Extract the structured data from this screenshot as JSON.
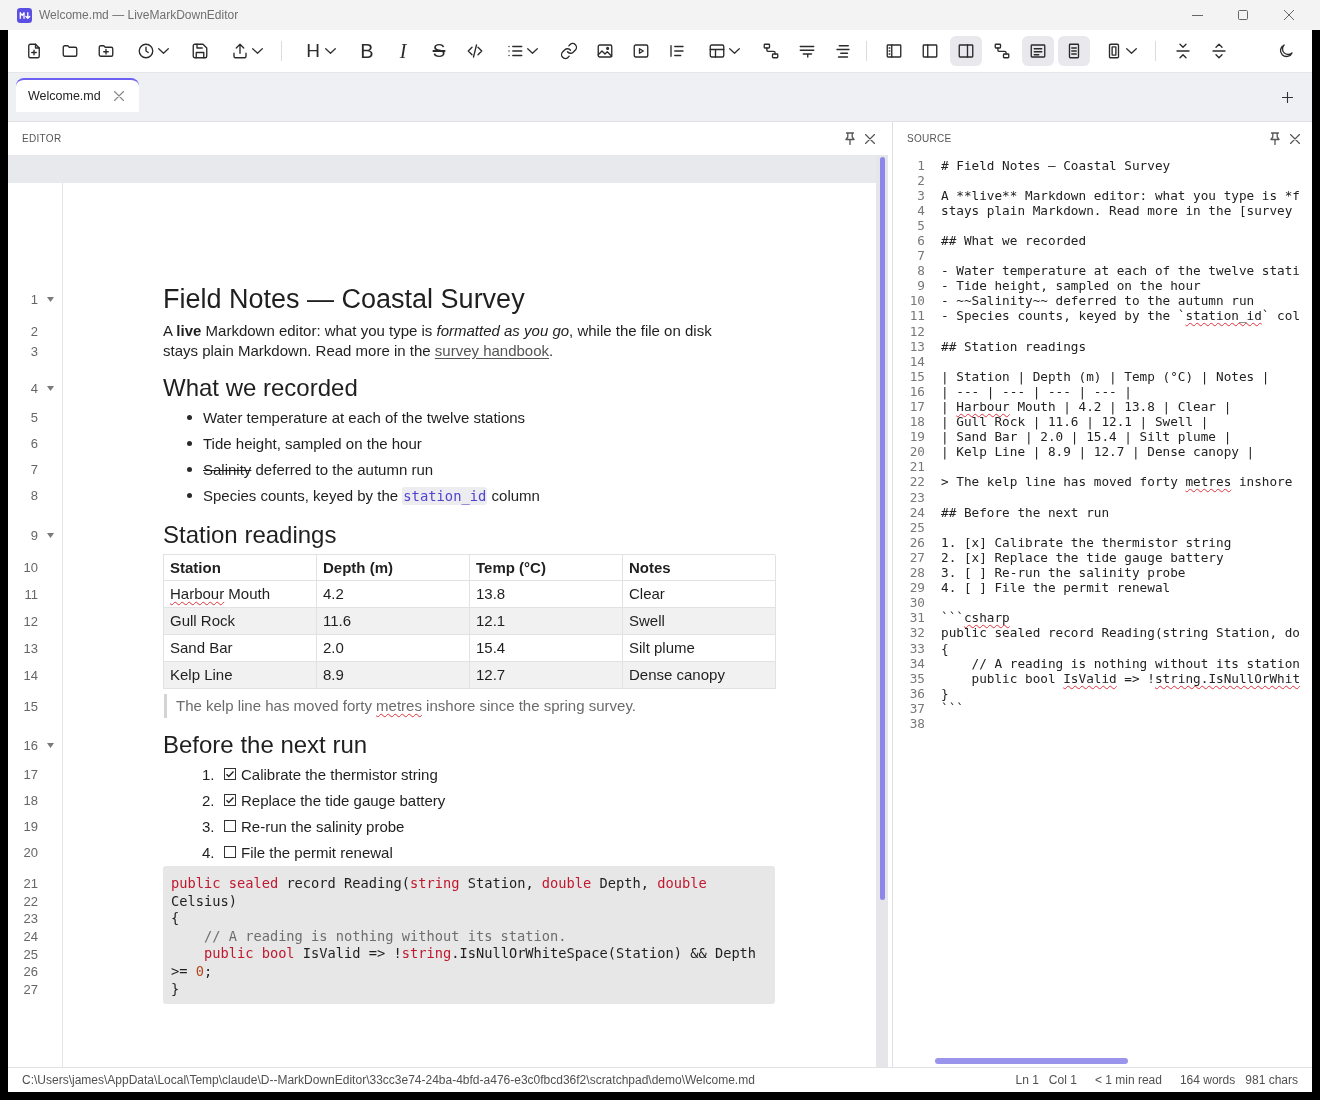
{
  "window": {
    "title": "Welcome.md — LiveMarkDownEditor"
  },
  "toolbar": [
    {
      "kind": "newfile",
      "selected": false,
      "dropdown": false
    },
    {
      "kind": "open",
      "selected": false,
      "dropdown": false
    },
    {
      "kind": "newfolder",
      "selected": false,
      "dropdown": false
    },
    {
      "kind": "history",
      "selected": false,
      "dropdown": true
    },
    {
      "kind": "save",
      "selected": false,
      "dropdown": false
    },
    {
      "kind": "export",
      "selected": false,
      "dropdown": true
    },
    {
      "kind": "separator"
    },
    {
      "kind": "heading",
      "label": "H",
      "selected": false,
      "dropdown": true
    },
    {
      "kind": "bold",
      "label": "B",
      "selected": false,
      "dropdown": false
    },
    {
      "kind": "italic",
      "label": "I",
      "selected": false,
      "dropdown": false
    },
    {
      "kind": "strike",
      "label": "S",
      "selected": false,
      "dropdown": false
    },
    {
      "kind": "code",
      "selected": false,
      "dropdown": false
    },
    {
      "kind": "list",
      "selected": false,
      "dropdown": true
    },
    {
      "kind": "link",
      "selected": false,
      "dropdown": false
    },
    {
      "kind": "image",
      "selected": false,
      "dropdown": false
    },
    {
      "kind": "video",
      "selected": false,
      "dropdown": false
    },
    {
      "kind": "quote",
      "selected": false,
      "dropdown": false
    },
    {
      "kind": "table",
      "selected": false,
      "dropdown": true
    },
    {
      "kind": "diagram",
      "selected": false,
      "dropdown": false
    },
    {
      "kind": "wrap",
      "selected": false,
      "dropdown": false
    },
    {
      "kind": "indent",
      "selected": false,
      "dropdown": false
    },
    {
      "kind": "separator"
    },
    {
      "kind": "sidebar",
      "selected": false,
      "dropdown": false
    },
    {
      "kind": "splitleft",
      "selected": false,
      "dropdown": false
    },
    {
      "kind": "splitright",
      "selected": true,
      "dropdown": false
    },
    {
      "kind": "diagram",
      "selected": false,
      "dropdown": false
    },
    {
      "kind": "prose",
      "selected": true,
      "dropdown": false
    },
    {
      "kind": "page",
      "selected": true,
      "dropdown": false
    },
    {
      "kind": "device",
      "selected": false,
      "dropdown": true
    },
    {
      "kind": "separator"
    },
    {
      "kind": "collapse",
      "selected": false,
      "dropdown": false
    },
    {
      "kind": "expand",
      "selected": false,
      "dropdown": false
    },
    {
      "kind": "theme",
      "selected": false,
      "dropdown": false
    }
  ],
  "tabs": [
    {
      "label": "Welcome.md",
      "selected": true
    }
  ],
  "editor": {
    "title": "EDITOR",
    "blocks": [
      {
        "kind": "heading1",
        "line_numbers": [
          "1"
        ],
        "expanded": true,
        "text": "Field Notes — Coastal Survey"
      },
      {
        "kind": "paragraph",
        "line_numbers": [
          "2",
          "3"
        ],
        "lines": [
          [
            {
              "kind": "text",
              "text": "A **live** Markdown editor: what you type is *formatted as you go*, while the file on disk"
            }
          ],
          [
            {
              "kind": "text",
              "text": "stays plain Markdown. Read more in the "
            },
            {
              "kind": "link",
              "text": "survey handbook"
            },
            {
              "kind": "text",
              "text": "."
            }
          ]
        ]
      },
      {
        "kind": "heading2",
        "line_numbers": [
          "4"
        ],
        "expanded": true,
        "text": "What we recorded"
      },
      {
        "kind": "bullet",
        "line_numbers": [
          "5"
        ],
        "segments": [
          {
            "kind": "text",
            "text": "Water temperature at each of the twelve stations"
          }
        ]
      },
      {
        "kind": "bullet",
        "line_numbers": [
          "6"
        ],
        "segments": [
          {
            "kind": "text",
            "text": "Tide height, sampled on the hour"
          }
        ]
      },
      {
        "kind": "bullet",
        "line_numbers": [
          "7"
        ],
        "segments": [
          {
            "kind": "strike",
            "text": "Salinity"
          },
          {
            "kind": "text",
            "text": " deferred to the autumn run"
          }
        ]
      },
      {
        "kind": "bullet",
        "line_numbers": [
          "8"
        ],
        "segments": [
          {
            "kind": "text",
            "text": "Species counts, keyed by the "
          },
          {
            "kind": "code",
            "text": "station_id"
          },
          {
            "kind": "text",
            "text": " column"
          }
        ]
      },
      {
        "kind": "heading2",
        "line_numbers": [
          "9"
        ],
        "expanded": true,
        "text": "Station readings"
      },
      {
        "kind": "table_header",
        "line_numbers": [
          "10"
        ],
        "cells": [
          "Station",
          "Depth (m)",
          "Temp (°C)",
          "Notes"
        ]
      },
      {
        "kind": "table_row",
        "line_numbers": [
          "11"
        ],
        "cells": [
          [
            {
              "kind": "misspelled",
              "text": "Harbour"
            },
            {
              "kind": "text",
              "text": " Mouth"
            }
          ],
          "4.2",
          "13.8",
          "Clear"
        ]
      },
      {
        "kind": "table_row",
        "line_numbers": [
          "12"
        ],
        "cells": [
          "Gull Rock",
          "11.6",
          "12.1",
          "Swell"
        ]
      },
      {
        "kind": "table_row",
        "line_numbers": [
          "13"
        ],
        "cells": [
          "Sand Bar",
          "2.0",
          "15.4",
          "Silt plume"
        ]
      },
      {
        "kind": "table_row",
        "line_numbers": [
          "14"
        ],
        "cells": [
          "Kelp Line",
          "8.9",
          "12.7",
          "Dense canopy"
        ]
      },
      {
        "kind": "quote",
        "line_numbers": [
          "15"
        ],
        "segments": [
          {
            "kind": "text",
            "text": "The kelp line has moved forty "
          },
          {
            "kind": "misspelled",
            "text": "metres"
          },
          {
            "kind": "text",
            "text": " inshore since the spring survey."
          }
        ]
      },
      {
        "kind": "heading2",
        "line_numbers": [
          "16"
        ],
        "expanded": true,
        "text": "Before the next run"
      },
      {
        "kind": "task",
        "line_numbers": [
          "17"
        ],
        "number": "1.",
        "checked": true,
        "text": "Calibrate the thermistor string"
      },
      {
        "kind": "task",
        "line_numbers": [
          "18"
        ],
        "number": "2.",
        "checked": true,
        "text": "Replace the tide gauge battery"
      },
      {
        "kind": "task",
        "line_numbers": [
          "19"
        ],
        "number": "3.",
        "checked": false,
        "text": "Re-run the salinity probe"
      },
      {
        "kind": "task",
        "line_numbers": [
          "20"
        ],
        "number": "4.",
        "checked": false,
        "text": "File the permit renewal"
      },
      {
        "kind": "code",
        "lines": [
          {
            "number": "21",
            "tokens": [
              {
                "kind": "keyword",
                "text": "public sealed"
              },
              {
                "kind": "plain",
                "text": " record Reading("
              },
              {
                "kind": "keyword",
                "text": "string"
              },
              {
                "kind": "plain",
                "text": " Station, "
              },
              {
                "kind": "keyword",
                "text": "double"
              },
              {
                "kind": "plain",
                "text": " Depth, "
              },
              {
                "kind": "keyword",
                "text": "double"
              }
            ]
          },
          {
            "number": "22",
            "tokens": [
              {
                "kind": "plain",
                "text": "Celsius)"
              }
            ]
          },
          {
            "number": "23",
            "tokens": [
              {
                "kind": "plain",
                "text": "{"
              }
            ]
          },
          {
            "number": "24",
            "tokens": [
              {
                "kind": "comment",
                "text": "    // A reading is nothing without its station."
              }
            ]
          },
          {
            "number": "25",
            "tokens": [
              {
                "kind": "keyword",
                "text": "    public bool"
              },
              {
                "kind": "plain",
                "text": " IsValid => !"
              },
              {
                "kind": "keyword",
                "text": "string"
              },
              {
                "kind": "plain",
                "text": ".IsNullOrWhiteSpace(Station) && Depth"
              }
            ]
          },
          {
            "number": "26",
            "tokens": [
              {
                "kind": "plain",
                "text": ">= "
              },
              {
                "kind": "number",
                "text": "0"
              },
              {
                "kind": "plain",
                "text": ";"
              }
            ]
          },
          {
            "number": "27",
            "tokens": [
              {
                "kind": "plain",
                "text": "}"
              }
            ]
          }
        ]
      }
    ]
  },
  "source": {
    "title": "SOURCE",
    "lines": [
      {
        "number": "1",
        "text": "# Field Notes — Coastal Survey"
      },
      {
        "number": "2"
      },
      {
        "number": "3",
        "text": "A **live** Markdown editor: what you type is *f"
      },
      {
        "number": "4",
        "text": "stays plain Markdown. Read more in the [survey"
      },
      {
        "number": "5"
      },
      {
        "number": "6",
        "text": "## What we recorded"
      },
      {
        "number": "7"
      },
      {
        "number": "8",
        "text": "- Water temperature at each of the twelve stati"
      },
      {
        "number": "9",
        "text": "- Tide height, sampled on the hour"
      },
      {
        "number": "10",
        "text": "- ~~Salinity~~ deferred to the autumn run"
      },
      {
        "number": "11",
        "segments": [
          {
            "kind": "text",
            "text": "- Species counts, keyed by the `"
          },
          {
            "kind": "misspelled",
            "text": "station_id"
          },
          {
            "kind": "text",
            "text": "` col"
          }
        ]
      },
      {
        "number": "12"
      },
      {
        "number": "13",
        "text": "## Station readings"
      },
      {
        "number": "14"
      },
      {
        "number": "15",
        "text": "| Station | Depth (m) | Temp (°C) | Notes |"
      },
      {
        "number": "16",
        "text": "| --- | --- | --- | --- |"
      },
      {
        "number": "17",
        "segments": [
          {
            "kind": "text",
            "text": "| "
          },
          {
            "kind": "misspelled",
            "text": "Harbour"
          },
          {
            "kind": "text",
            "text": " Mouth | 4.2 | 13.8 | Clear |"
          }
        ]
      },
      {
        "number": "18",
        "text": "| Gull Rock | 11.6 | 12.1 | Swell |"
      },
      {
        "number": "19",
        "text": "| Sand Bar | 2.0 | 15.4 | Silt plume |"
      },
      {
        "number": "20",
        "text": "| Kelp Line | 8.9 | 12.7 | Dense canopy |"
      },
      {
        "number": "21"
      },
      {
        "number": "22",
        "segments": [
          {
            "kind": "text",
            "text": "> The kelp line has moved forty "
          },
          {
            "kind": "misspelled",
            "text": "metres"
          },
          {
            "kind": "text",
            "text": " inshore"
          }
        ]
      },
      {
        "number": "23"
      },
      {
        "number": "24",
        "text": "## Before the next run"
      },
      {
        "number": "25"
      },
      {
        "number": "26",
        "text": "1. [x] Calibrate the thermistor string"
      },
      {
        "number": "27",
        "text": "2. [x] Replace the tide gauge battery"
      },
      {
        "number": "28",
        "text": "3. [ ] Re-run the salinity probe"
      },
      {
        "number": "29",
        "text": "4. [ ] File the permit renewal"
      },
      {
        "number": "30"
      },
      {
        "number": "31",
        "segments": [
          {
            "kind": "text",
            "text": "```"
          },
          {
            "kind": "misspelled",
            "text": "csharp"
          }
        ]
      },
      {
        "number": "32",
        "text": "public sealed record Reading(string Station, do"
      },
      {
        "number": "33",
        "text": "{"
      },
      {
        "number": "34",
        "text": "    // A reading is nothing without its station"
      },
      {
        "number": "35",
        "segments": [
          {
            "kind": "text",
            "text": "    public bool "
          },
          {
            "kind": "misspelled",
            "text": "IsValid"
          },
          {
            "kind": "text",
            "text": " => !"
          },
          {
            "kind": "misspelled",
            "text": "string.IsNullOrWhit"
          }
        ]
      },
      {
        "number": "36",
        "text": "}"
      },
      {
        "number": "37",
        "text": "```"
      },
      {
        "number": "38"
      }
    ]
  },
  "status_bar": {
    "path": "C:\\Users\\james\\AppData\\Local\\Temp\\claude\\D--MarkDownEditor\\33cc3e74-24ba-4bfd-a476-e3c0fbcd36f2\\scratchpad\\demo\\Welcome.md",
    "groups": [
      [
        "Ln 1",
        "Col 1"
      ],
      [
        "< 1 min read"
      ],
      [
        "164 words",
        "981 chars"
      ]
    ]
  }
}
